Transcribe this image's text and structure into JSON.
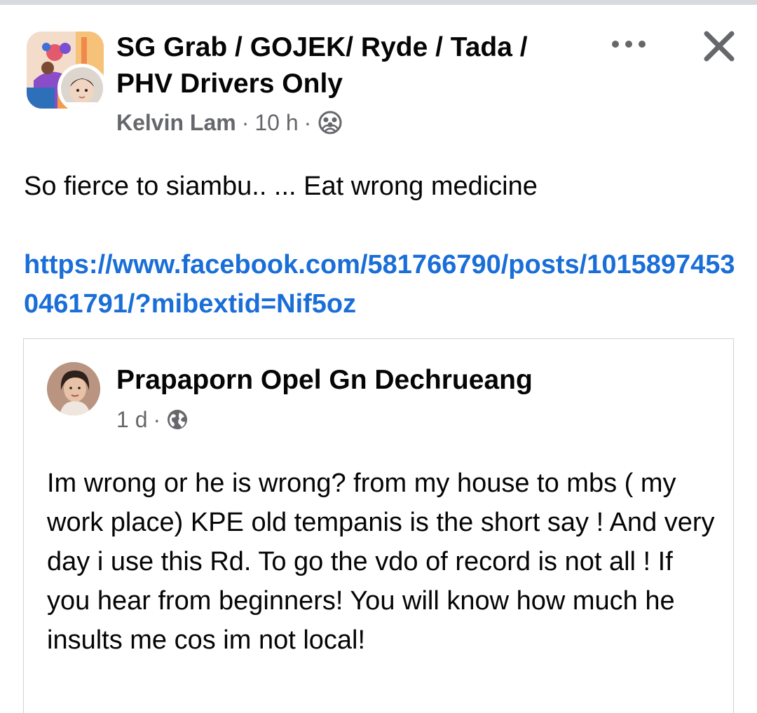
{
  "header": {
    "group_name": "SG Grab / GOJEK/ Ryde / Tada / PHV Drivers Only",
    "author": "Kelvin Lam",
    "time": "10 h",
    "separator": "·",
    "audience_icon": "group-members-icon",
    "more_icon": "more-options-icon",
    "close_icon": "close-icon"
  },
  "post": {
    "text": "So fierce to siambu.. ... Eat wrong medicine",
    "link": "https://www.facebook.com/581766790/posts/10158974530461791/?mibextid=Nif5oz"
  },
  "shared": {
    "author": "Prapaporn Opel Gn Dechrueang",
    "time": "1 d",
    "separator": "·",
    "audience_icon": "public-globe-icon",
    "text": "Im wrong or he is wrong? from my house to mbs ( my work place) KPE old tempanis is the short say ! And very day i use this Rd. To go the vdo of record is not all ! If you hear from beginners! You will know how much he insults me cos im not local!"
  },
  "colors": {
    "link": "#1a6ed8",
    "secondary_text": "#65676b",
    "primary_text": "#050505",
    "card_border": "#d0d2d6"
  }
}
